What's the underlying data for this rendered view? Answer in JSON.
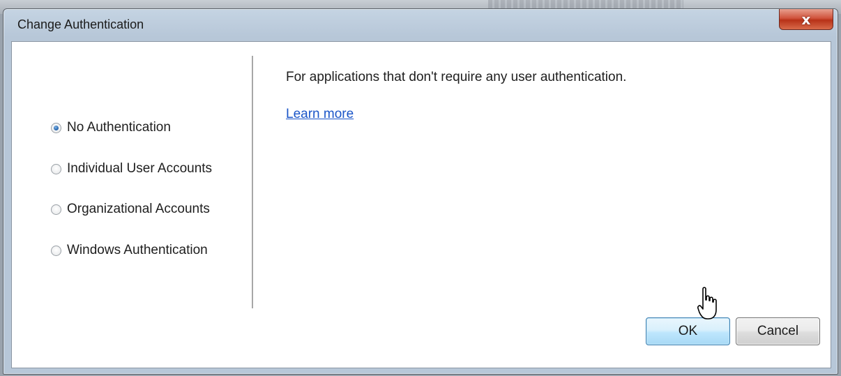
{
  "dialog": {
    "title": "Change Authentication",
    "close_glyph": "x"
  },
  "auth_options": [
    {
      "label": "No Authentication",
      "checked": true
    },
    {
      "label": "Individual User Accounts",
      "checked": false
    },
    {
      "label": "Organizational Accounts",
      "checked": false
    },
    {
      "label": "Windows Authentication",
      "checked": false
    }
  ],
  "details": {
    "description": "For applications that don't require any user authentication.",
    "learn_more": "Learn more"
  },
  "buttons": {
    "ok": "OK",
    "cancel": "Cancel"
  },
  "colors": {
    "link": "#1a55c8",
    "close_button": "#c8432b",
    "ok_button_border": "#3c7fb1"
  },
  "icons": {
    "close": "close-icon",
    "cursor": "hand-pointer-cursor-icon",
    "radio_selected": "radio-selected-icon",
    "radio_unselected": "radio-unselected-icon"
  }
}
